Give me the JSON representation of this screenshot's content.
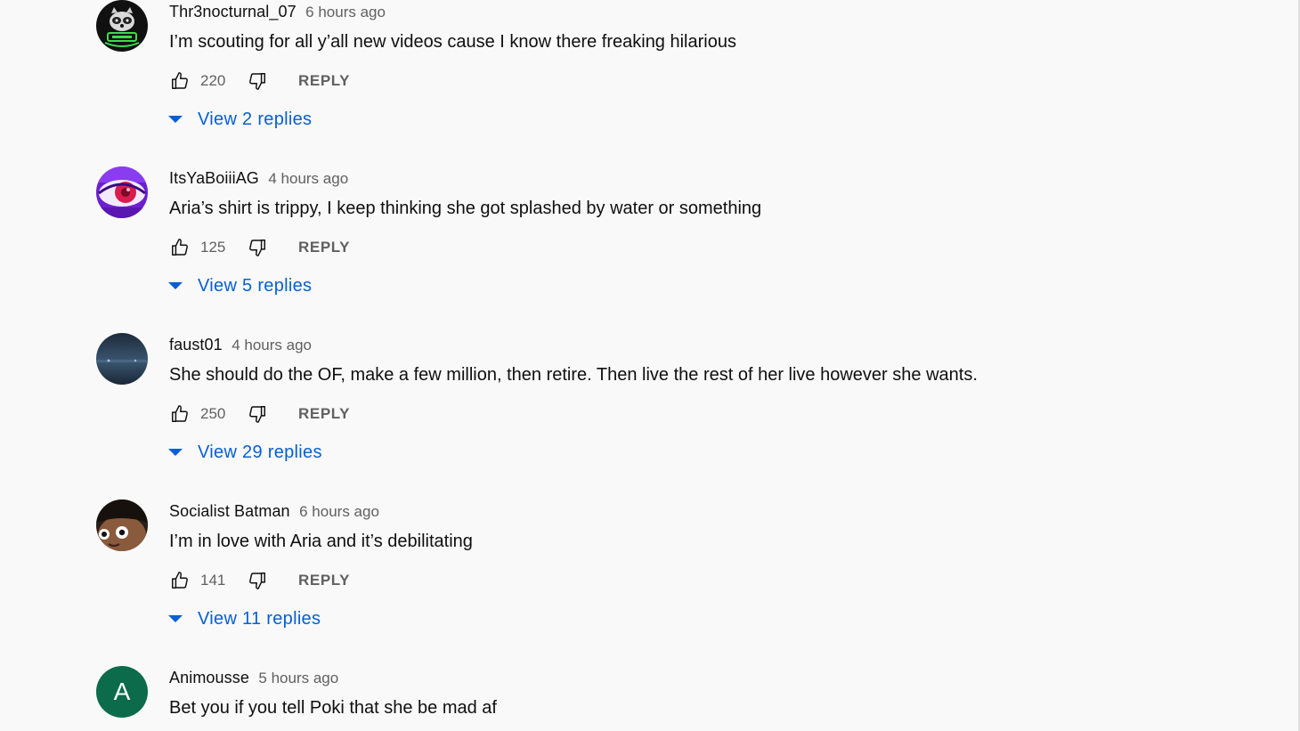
{
  "comments": [
    {
      "author": "Thr3nocturnal_07",
      "time": "6 hours ago",
      "text": "I’m scouting for all y’all new videos cause I know there freaking hilarious",
      "likes": "220",
      "reply_label": "REPLY",
      "replies_label": "View 2 replies",
      "avatar": "raccoon-avatar-icon"
    },
    {
      "author": "ItsYaBoiiiAG",
      "time": "4 hours ago",
      "text": "Aria’s shirt is trippy, I keep thinking she got splashed by water or something",
      "likes": "125",
      "reply_label": "REPLY",
      "replies_label": "View 5 replies",
      "avatar": "purple-eye-avatar-icon"
    },
    {
      "author": "faust01",
      "time": "4 hours ago",
      "text": "She should do the OF, make a few million, then retire. Then live the rest of her live however she wants.",
      "likes": "250",
      "reply_label": "REPLY",
      "replies_label": "View 29 replies",
      "avatar": "dark-landscape-avatar-icon"
    },
    {
      "author": "Socialist Batman",
      "time": "6 hours ago",
      "text": "I’m in love with Aria and it’s debilitating",
      "likes": "141",
      "reply_label": "REPLY",
      "replies_label": "View 11 replies",
      "avatar": "cartoon-face-avatar-icon"
    },
    {
      "author": "Animousse",
      "time": "5 hours ago",
      "text": "Bet you if you tell Poki that she be mad af",
      "avatar_letter": "A",
      "avatar": "letter-a-avatar-icon"
    }
  ],
  "colors": {
    "background": "#f9f9f9",
    "link_blue": "#065fd4",
    "secondary_text": "#606060",
    "primary_text": "#0f0f0f",
    "letter_avatar_bg": "#0b6b4a"
  }
}
